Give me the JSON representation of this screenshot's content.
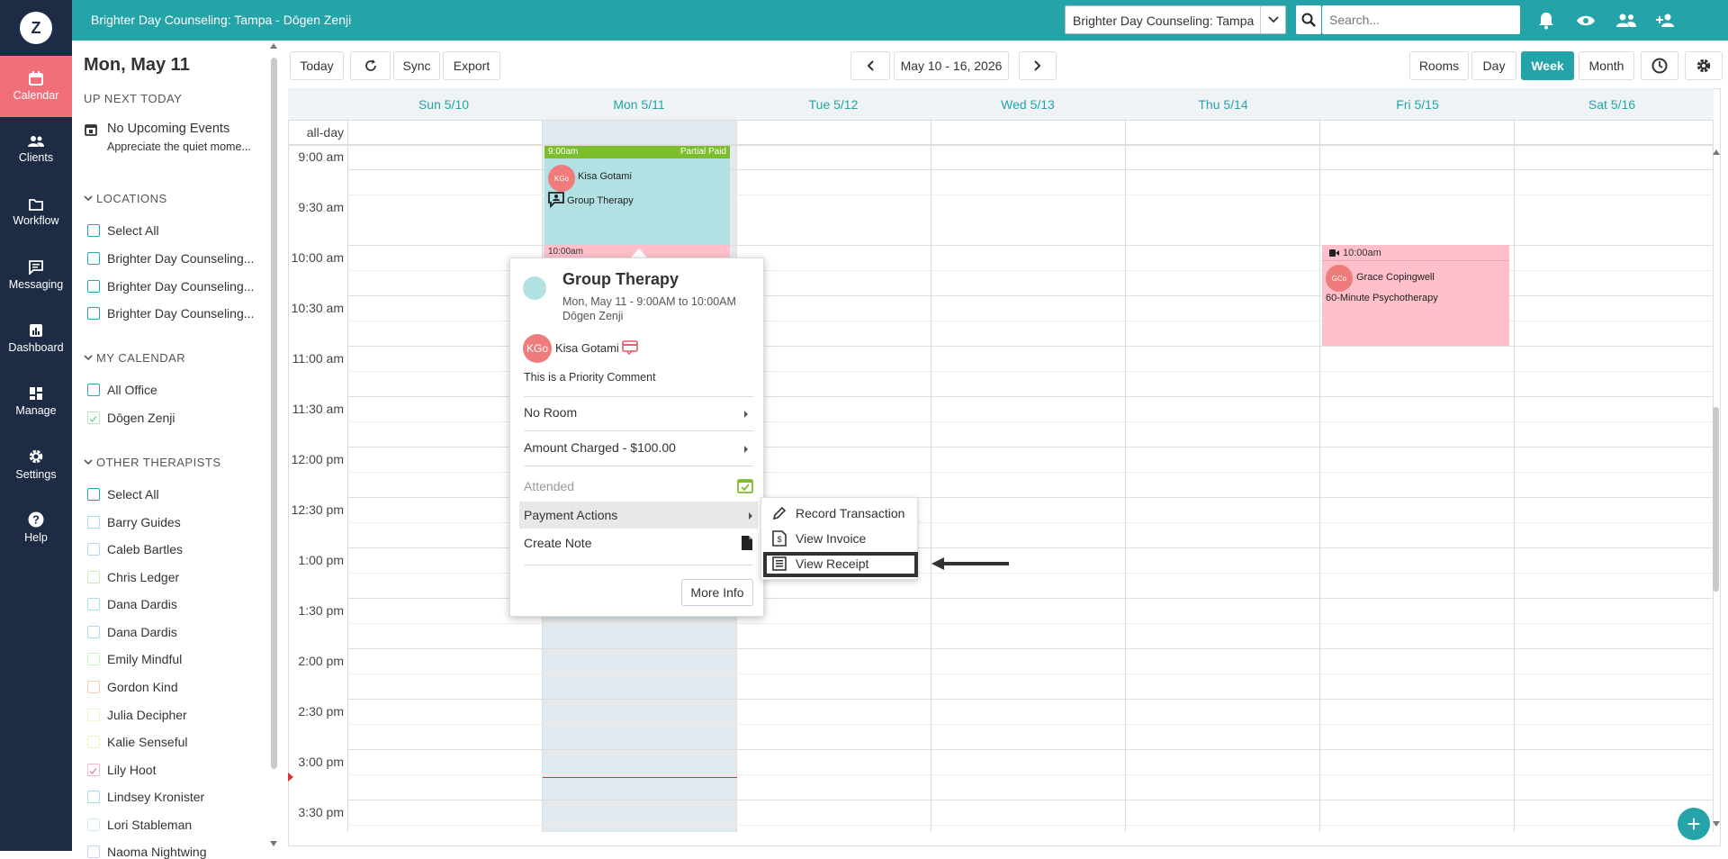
{
  "app": {
    "logo": "Z",
    "title": "Brighter Day Counseling: Tampa - Dōgen Zenji"
  },
  "topbar": {
    "practice_select": "Brighter Day Counseling: Tampa",
    "search_placeholder": "Search...",
    "icons": [
      "bell-icon",
      "eye-icon",
      "users-icon",
      "add-user-icon"
    ]
  },
  "nav": {
    "items": [
      {
        "label": "Calendar",
        "icon": "calendar-icon"
      },
      {
        "label": "Clients",
        "icon": "clients-icon"
      },
      {
        "label": "Workflow",
        "icon": "folder-icon"
      },
      {
        "label": "Messaging",
        "icon": "message-icon"
      },
      {
        "label": "Dashboard",
        "icon": "chart-icon"
      },
      {
        "label": "Manage",
        "icon": "grid-icon"
      },
      {
        "label": "Settings",
        "icon": "gear-icon"
      },
      {
        "label": "Help",
        "icon": "help-icon"
      }
    ]
  },
  "sidebar": {
    "date": "Mon, May 11",
    "up_next_title": "UP NEXT TODAY",
    "no_events": "No Upcoming Events",
    "no_events_sub": "Appreciate the quiet mome...",
    "locations_title": "LOCATIONS",
    "locations": [
      "Select All",
      "Brighter Day Counseling...",
      "Brighter Day Counseling...",
      "Brighter Day Counseling..."
    ],
    "my_calendar_title": "MY CALENDAR",
    "my_calendar": [
      "All Office",
      "Dōgen Zenji"
    ],
    "other_title": "OTHER THERAPISTS",
    "others": [
      "Select All",
      "Barry Guides",
      "Caleb Bartles",
      "Chris Ledger",
      "Dana Dardis",
      "Dana Dardis",
      "Emily Mindful",
      "Gordon Kind",
      "Julia Decipher",
      "Kalie Senseful",
      "Lily Hoot",
      "Lindsey Kronister",
      "Lori Stableman",
      "Naoma Nightwing"
    ]
  },
  "toolbar": {
    "today": "Today",
    "sync": "Sync",
    "export": "Export",
    "range": "May 10 - 16, 2026",
    "rooms": "Rooms",
    "day": "Day",
    "week": "Week",
    "month": "Month"
  },
  "calendar": {
    "days": [
      "Sun 5/10",
      "Mon 5/11",
      "Tue 5/12",
      "Wed 5/13",
      "Thu 5/14",
      "Fri 5/15",
      "Sat 5/16"
    ],
    "allday": "all-day",
    "times": [
      "9:00 am",
      "9:30 am",
      "10:00 am",
      "10:30 am",
      "11:00 am",
      "11:30 am",
      "12:00 pm",
      "12:30 pm",
      "1:00 pm",
      "1:30 pm",
      "2:00 pm",
      "2:30 pm",
      "3:00 pm",
      "3:30 pm"
    ]
  },
  "events": {
    "ev1": {
      "time": "9:00am",
      "status": "Partial Paid",
      "initials": "KGo",
      "client": "Kisa Gotami",
      "type": "Group Therapy"
    },
    "ev2": {
      "time": "10:00am"
    },
    "ev3": {
      "time": "10:00am",
      "initials": "GCo",
      "client": "Grace Copingwell",
      "type": "60-Minute Psychotherapy"
    }
  },
  "popup": {
    "title": "Group Therapy",
    "when": "Mon, May 11 - 9:00AM to 10:00AM",
    "clinician": "Dōgen Zenji",
    "initials": "KGo",
    "client": "Kisa Gotami",
    "comment": "This is a Priority Comment",
    "room": "No Room",
    "amount": "Amount Charged - $100.00",
    "attended": "Attended",
    "payment_actions": "Payment Actions",
    "create_note": "Create Note",
    "more_info": "More Info",
    "color_dot": "#b2e1e4"
  },
  "submenu": {
    "record": "Record Transaction",
    "invoice": "View Invoice",
    "receipt": "View Receipt"
  },
  "colors": {
    "accent": "#24a3a9",
    "nav": "#1d2b44",
    "active_nav": "#f06f7a"
  }
}
